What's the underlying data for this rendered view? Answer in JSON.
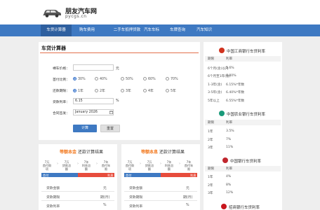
{
  "header": {
    "logo_title": "朋友汽车网",
    "logo_sub": "pycgs.cn"
  },
  "nav": {
    "items": [
      {
        "label": "车贷计算器"
      },
      {
        "label": "购车费用"
      },
      {
        "label": "二手车抵押贷款"
      },
      {
        "label": "汽车车标"
      },
      {
        "label": "车牌查询"
      },
      {
        "label": "汽车知识"
      }
    ]
  },
  "calculator": {
    "title": "车贷计算器",
    "price_label": "裸车价格：",
    "price_value": "",
    "price_unit": "元",
    "down_label": "首付比例：",
    "down_options": [
      "30%",
      "40%",
      "50%",
      "60%",
      "70%"
    ],
    "term_label": "还款期限：",
    "term_options": [
      "1年",
      "2年",
      "3年",
      "4年",
      "5年"
    ],
    "rate_label": "贷款利率：",
    "rate_value": "6.15",
    "rate_unit": "%",
    "date_label": "合同签发：",
    "date_value": "January 2026",
    "calc_button": "计算",
    "reset_button": "重置"
  },
  "results": [
    {
      "highlight": "等额本金",
      "title_suffix": "还款计算结果",
      "steps": [
        {
          "line1": "7万",
          "line2": "首付款项"
        },
        {
          "line1": "7万",
          "line2": "贷款总额"
        },
        {
          "line1": "7年",
          "line2": "利息总额"
        },
        {
          "line1": "7年",
          "line2": "首付年限"
        }
      ],
      "bar_left": "首付",
      "bar_right": "利息",
      "rows": [
        {
          "label": "贷款金额",
          "unit": "元"
        },
        {
          "label": "贷款期限",
          "unit": "期(月)"
        },
        {
          "label": "贷款利率",
          "unit": "%"
        }
      ]
    },
    {
      "highlight": "等额本息",
      "title_suffix": "还款计算结果",
      "steps": [
        {
          "line1": "7万",
          "line2": "首付款项"
        },
        {
          "line1": "7万",
          "line2": "贷款总额"
        },
        {
          "line1": "7年",
          "line2": "利息总额"
        },
        {
          "line1": "7年",
          "line2": "首付年限"
        }
      ],
      "bar_left": "首付",
      "bar_right": "利息",
      "rows": [
        {
          "label": "贷款金额",
          "unit": "元"
        },
        {
          "label": "贷款期限",
          "unit": "期(月)"
        },
        {
          "label": "贷款利率",
          "unit": "%"
        }
      ]
    }
  ],
  "banks": [
    {
      "name": "中国工商银行车贷利率",
      "color": "#d0321e",
      "col1": "期限",
      "col2": "利率",
      "rows": [
        [
          "6个月(含)以内",
          "5.6%"
        ],
        [
          "6个月至1年(含)",
          "6.00%"
        ],
        [
          "1-3年(含)",
          "6.15%*年数"
        ],
        [
          "3-5年(含)",
          "6.40%*年数"
        ],
        [
          "5年以上",
          "6.55%*年数"
        ]
      ]
    },
    {
      "name": "中国农业银行车贷利率",
      "color": "#1a9a7a",
      "col1": "期限",
      "col2": "利率",
      "rows": [
        [
          "1年",
          "3.5%"
        ],
        [
          "2年",
          "7%"
        ],
        [
          "3年",
          "11%"
        ]
      ]
    },
    {
      "name": "中国银行车贷利率",
      "color": "#c0262d",
      "col1": "期限",
      "col2": "利率",
      "rows": [
        [
          "1年",
          "4%"
        ],
        [
          "2年",
          "8%"
        ],
        [
          "3年",
          "12%"
        ]
      ]
    },
    {
      "name": "招商银行车贷利率",
      "color": "#c8161d",
      "rows": []
    }
  ]
}
